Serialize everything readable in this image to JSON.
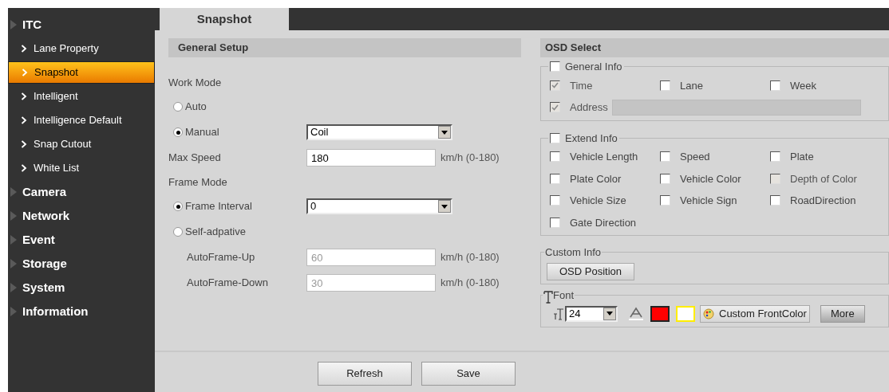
{
  "sidebar": {
    "groups": [
      {
        "label": "ITC",
        "children": [
          {
            "label": "Lane Property",
            "selected": false
          },
          {
            "label": "Snapshot",
            "selected": true
          },
          {
            "label": "Intelligent",
            "selected": false
          },
          {
            "label": "Intelligence Default",
            "selected": false
          },
          {
            "label": "Snap Cutout",
            "selected": false
          },
          {
            "label": "White List",
            "selected": false
          }
        ]
      },
      {
        "label": "Camera"
      },
      {
        "label": "Network"
      },
      {
        "label": "Event"
      },
      {
        "label": "Storage"
      },
      {
        "label": "System"
      },
      {
        "label": "Information"
      }
    ]
  },
  "tabs": [
    {
      "label": "Snapshot",
      "selected": true
    }
  ],
  "general_setup": {
    "title": "General Setup",
    "rows": [
      {
        "kind": "heading",
        "label": "Work Mode"
      },
      {
        "kind": "radio",
        "label": "Auto",
        "selected": false
      },
      {
        "kind": "radio",
        "label": "Manual",
        "selected": true,
        "select": "Coil"
      },
      {
        "kind": "field",
        "label": "Max Speed",
        "value": "180",
        "unit": "km/h (0-180)",
        "disabled": false
      },
      {
        "kind": "heading",
        "label": "Frame Mode"
      },
      {
        "kind": "radio",
        "label": "Frame Interval",
        "selected": true,
        "select": "0"
      },
      {
        "kind": "radio",
        "label": "Self-adpative",
        "selected": false
      },
      {
        "kind": "subfield",
        "label": "AutoFrame-Up",
        "value": "60",
        "unit": "km/h (0-180)",
        "disabled": true
      },
      {
        "kind": "subfield",
        "label": "AutoFrame-Down",
        "value": "30",
        "unit": "km/h (0-180)",
        "disabled": true
      }
    ]
  },
  "osd_select": {
    "title": "OSD Select",
    "general_info": {
      "label": "General Info",
      "checked": false,
      "items": [
        {
          "kind": "check",
          "label": "Time",
          "checked": true,
          "disabled": true
        },
        {
          "kind": "check",
          "label": "Lane",
          "checked": false,
          "disabled": false
        },
        {
          "kind": "check",
          "label": "Week",
          "checked": false,
          "disabled": false
        },
        {
          "kind": "check_field",
          "label": "Address",
          "checked": true,
          "disabled": true
        }
      ]
    },
    "extend_info": {
      "label": "Extend Info",
      "checked": false,
      "items": [
        {
          "label": "Vehicle Length",
          "checked": false,
          "disabled": false
        },
        {
          "label": "Speed",
          "checked": false,
          "disabled": false
        },
        {
          "label": "Plate",
          "checked": false,
          "disabled": false
        },
        {
          "label": "Plate Color",
          "checked": false,
          "disabled": false
        },
        {
          "label": "Vehicle Color",
          "checked": false,
          "disabled": false
        },
        {
          "label": "Depth of Color",
          "checked": false,
          "disabled": true
        },
        {
          "label": "Vehicle Size",
          "checked": false,
          "disabled": false
        },
        {
          "label": "Vehicle Sign",
          "checked": false,
          "disabled": false
        },
        {
          "label": "RoadDirection",
          "checked": false,
          "disabled": false
        },
        {
          "label": "Gate Direction",
          "checked": false,
          "disabled": false
        }
      ]
    },
    "custom_info": {
      "label": "Custom Info",
      "button": "OSD Position"
    },
    "font": {
      "label": "Font",
      "size": "24",
      "swatches": [
        {
          "color": "#ff0000"
        },
        {
          "color": "#ffffff"
        }
      ],
      "custom_button": "Custom FrontColor",
      "more_button": "More"
    }
  },
  "buttons": [
    "Refresh",
    "Save"
  ]
}
